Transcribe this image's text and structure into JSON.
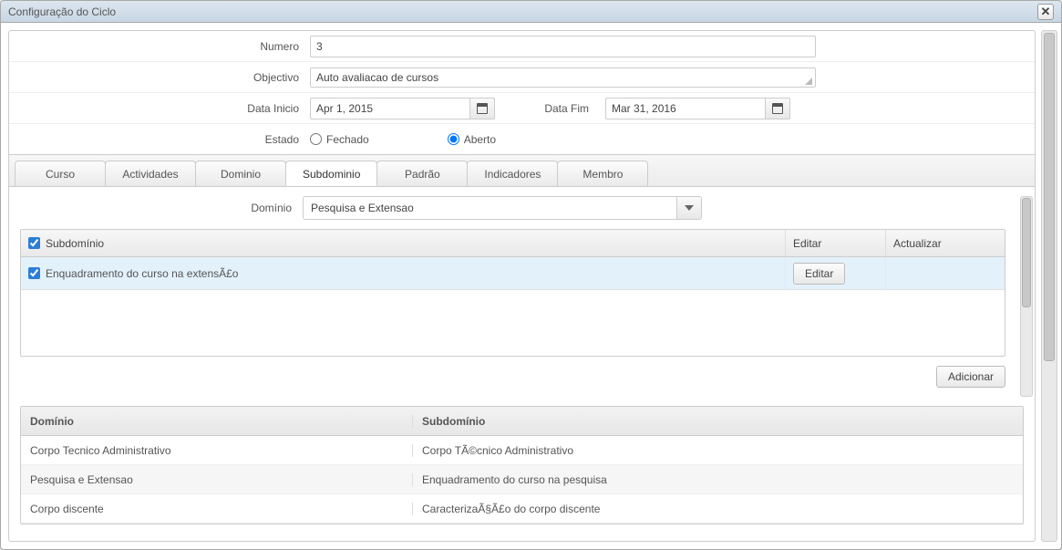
{
  "dialog": {
    "title": "Configuração do Ciclo"
  },
  "form": {
    "numero_label": "Numero",
    "numero_value": "3",
    "objectivo_label": "Objectivo",
    "objectivo_value": "Auto avaliacao de cursos",
    "datainicio_label": "Data Inicio",
    "datainicio_value": "Apr 1, 2015",
    "datafim_label": "Data Fim",
    "datafim_value": "Mar 31, 2016",
    "estado_label": "Estado",
    "estado_fechado": "Fechado",
    "estado_aberto": "Aberto"
  },
  "tabs": {
    "curso": "Curso",
    "actividades": "Actividades",
    "dominio": "Dominio",
    "subdominio": "Subdominio",
    "padrao": "Padrão",
    "indicadores": "Indicadores",
    "membro": "Membro"
  },
  "subdom": {
    "dominio_label": "Domínio",
    "dominio_combo_value": "Pesquisa e Extensao",
    "col_subdominio": "Subdomínio",
    "col_editar": "Editar",
    "col_actualizar": "Actualizar",
    "row1_text": "Enquadramento do curso na extensÃ£o",
    "btn_editar": "Editar",
    "btn_adicionar": "Adicionar"
  },
  "grid2": {
    "col_dominio": "Domínio",
    "col_subdominio": "Subdomínio",
    "rows": [
      {
        "d": "Corpo Tecnico Administrativo",
        "s": "Corpo TÃ©cnico Administrativo"
      },
      {
        "d": "Pesquisa e Extensao",
        "s": "Enquadramento do curso na pesquisa"
      },
      {
        "d": "Corpo discente",
        "s": "CaracterizaÃ§Ã£o do corpo discente"
      }
    ]
  }
}
